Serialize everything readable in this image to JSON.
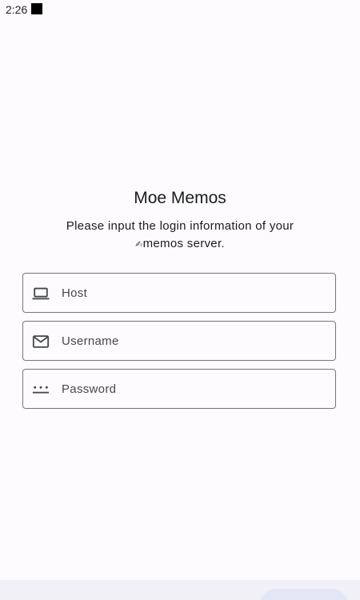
{
  "status_bar": {
    "time": "2:26"
  },
  "login": {
    "title": "Moe Memos",
    "subtitle_line1": "Please input the login information of your",
    "subtitle_glyph": "✍",
    "subtitle_line2": "memos server.",
    "fields": {
      "host": {
        "label": "Host",
        "icon": "laptop-icon"
      },
      "username": {
        "label": "Username",
        "icon": "mail-icon"
      },
      "password": {
        "label": "Password",
        "icon": "password-icon"
      }
    }
  },
  "colors": {
    "background": "#fdfbfe",
    "outline": "#77767a",
    "bottom_bar": "#f1f0f7",
    "button": "#e3e6f5"
  }
}
